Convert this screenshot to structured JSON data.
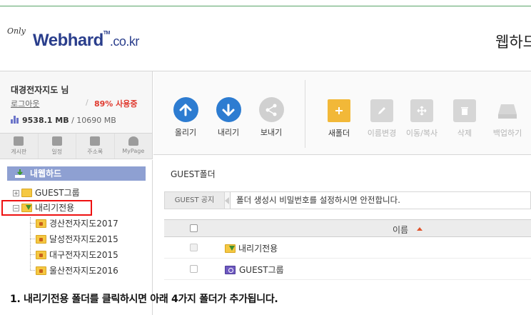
{
  "header": {
    "logo_only": "Only",
    "logo_main": "Webhard",
    "logo_tm": "TM",
    "logo_domain": ".co.kr",
    "title": "웹하드"
  },
  "user": {
    "name": "대경전자지도 님",
    "logout": "로그아웃",
    "usage_sep": "/",
    "usage": "89% 사용중",
    "used": "9538.1 MB",
    "total": "/ 10690 MB"
  },
  "quicknav": [
    {
      "label": "게시판",
      "icon": "board-icon"
    },
    {
      "label": "일정",
      "icon": "calendar-icon"
    },
    {
      "label": "주소록",
      "icon": "addressbook-icon"
    },
    {
      "label": "MyPage",
      "icon": "user-icon"
    }
  ],
  "toolbar": {
    "upload": "올리기",
    "download": "내리기",
    "send": "보내기",
    "new_folder": "새폴더",
    "rename": "이름변경",
    "move_copy": "이동/복사",
    "delete": "삭제",
    "backup": "백업하기"
  },
  "tree": {
    "root": "내웹하드",
    "items": [
      {
        "label": "GUEST그룹"
      },
      {
        "label": "내리기전용"
      },
      {
        "label": "경산전자지도2017"
      },
      {
        "label": "달성전자지도2015"
      },
      {
        "label": "대구전자지도2015"
      },
      {
        "label": "울산전자지도2016"
      }
    ]
  },
  "content": {
    "breadcrumb": "GUEST폴더",
    "notice_label": "GUEST 공지",
    "notice_text": "폴더 생성시 비밀번호를 설정하시면 안전합니다.",
    "col_name": "이름",
    "rows": [
      {
        "name": "내리기전용"
      },
      {
        "name": "GUEST그룹"
      }
    ]
  },
  "instruction": "1. 내리기전용 폴더를 클릭하시면 아래 4가지 폴더가 추가됩니다.",
  "colors": {
    "brand_blue": "#2a3e8c",
    "action_blue": "#2d7cd1",
    "usage_red": "#e03a2f",
    "highlight_red": "#ee1111"
  }
}
